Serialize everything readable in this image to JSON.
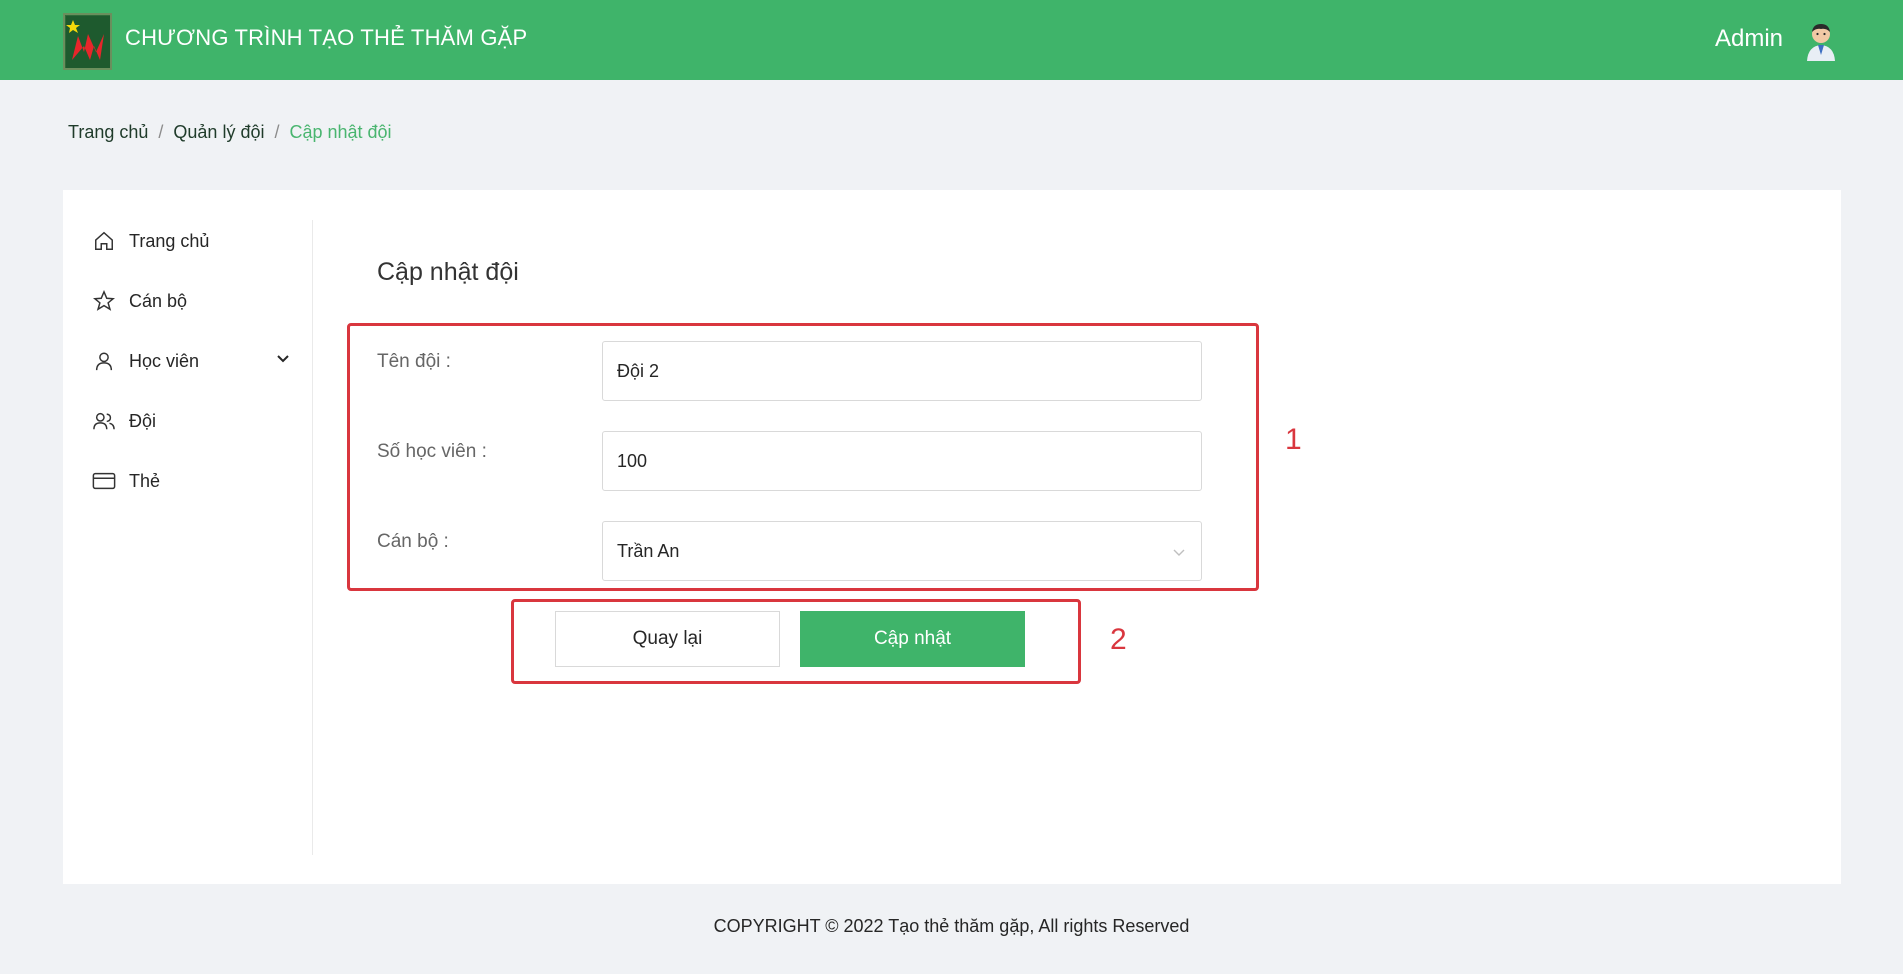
{
  "header": {
    "app_title": "CHƯƠNG TRÌNH TẠO THẺ THĂM GẶP",
    "user_name": "Admin",
    "brand_color": "#3fb46a"
  },
  "breadcrumb": [
    {
      "label": "Trang chủ"
    },
    {
      "label": "Quản lý đội"
    },
    {
      "label": "Cập nhật đội"
    }
  ],
  "breadcrumb_separator": "/",
  "sidebar": {
    "items": [
      {
        "label": "Trang chủ",
        "icon": "home-icon"
      },
      {
        "label": "Cán bộ",
        "icon": "star-icon"
      },
      {
        "label": "Học viên",
        "icon": "user-icon",
        "has_submenu": true
      },
      {
        "label": "Đội",
        "icon": "team-icon"
      },
      {
        "label": "Thẻ",
        "icon": "card-icon"
      }
    ]
  },
  "form": {
    "title": "Cập nhật đội",
    "fields": {
      "team_name": {
        "label": "Tên đội :",
        "value": "Đội 2"
      },
      "student_count": {
        "label": "Số học viên :",
        "value": "100"
      },
      "officer": {
        "label": "Cán bộ :",
        "value": "Trần An"
      }
    },
    "back_label": "Quay lại",
    "update_label": "Cập nhật"
  },
  "annotations": {
    "form_marker": "1",
    "buttons_marker": "2",
    "color": "#d9363e"
  },
  "footer": {
    "copyright": "COPYRIGHT © 2022 Tạo thẻ thăm gặp, All rights Reserved"
  }
}
